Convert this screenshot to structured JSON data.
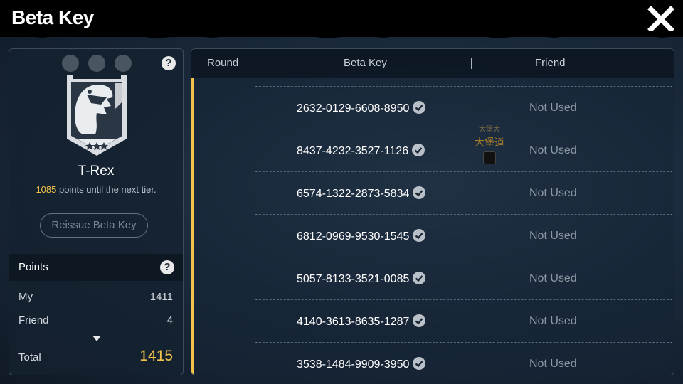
{
  "header": {
    "title": "Beta Key",
    "close_icon": "close-x-icon"
  },
  "rank_panel": {
    "rank_name": "T-Rex",
    "points_to_next": "1085",
    "next_tier_text": " points until the next tier.",
    "reissue_label": "Reissue Beta Key",
    "help_label": "?",
    "points_title": "Points",
    "points_help_label": "?",
    "my_label": "My",
    "my_value": "1411",
    "friend_label": "Friend",
    "friend_value": "4",
    "total_label": "Total",
    "total_value": "1415",
    "badge_icon": "t-rex-badge-icon"
  },
  "table": {
    "headers": [
      "Round",
      "Beta Key",
      "Friend"
    ],
    "rows": [
      {
        "key": "2632-0129-6608-8950",
        "friend": "Not Used"
      },
      {
        "key": "8437-4232-3527-1126",
        "friend": "Not Used"
      },
      {
        "key": "6574-1322-2873-5834",
        "friend": "Not Used"
      },
      {
        "key": "6812-0969-9530-1545",
        "friend": "Not Used"
      },
      {
        "key": "5057-8133-3521-0085",
        "friend": "Not Used"
      },
      {
        "key": "4140-3613-8635-1287",
        "friend": "Not Used"
      },
      {
        "key": "3538-1484-9909-3950",
        "friend": "Not Used"
      }
    ]
  },
  "watermark": {
    "small": "大堡大",
    "big": "大堡道"
  },
  "colors": {
    "accent_gold": "#f2c34a",
    "muted_text": "#8d98a5"
  }
}
